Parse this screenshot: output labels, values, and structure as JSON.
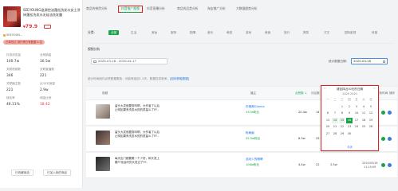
{
  "product": {
    "title": "SEEYOUNG滋源控油蓬松洗发水女士涂抹蓬松洗发水无硅油洗发露",
    "price_symbol": "¥",
    "price": "79.9",
    "shop_meta": "SEEYOUN... ",
    "badge": "已带货达 排行榜已有数据 4 位"
  },
  "stats": [
    {
      "label": "抖音浏览量",
      "value": "140.7w",
      "red": false
    },
    {
      "label": "全网销量",
      "value": "16.5w",
      "red": false
    },
    {
      "label": "关联视频数",
      "value": "346",
      "red": false
    },
    {
      "label": "关联直播数",
      "value": "221",
      "red": false
    },
    {
      "label": "关联播主数",
      "value": "221",
      "red": false
    },
    {
      "label": "近30天销量",
      "value": "2.9w",
      "red": false
    },
    {
      "label": "转化率",
      "value": "46.11%",
      "red": false
    },
    {
      "label": "佣金比例",
      "value": "18.42",
      "red": true
    }
  ],
  "bottom_buttons": [
    "已收藏商品",
    "已加入我的商品"
  ],
  "tabs": [
    "商品的带货分析",
    "抖音推广视频",
    "抖音直播分析",
    "商品的品类分析",
    "淘宝推广分析",
    "大数据趋势分析"
  ],
  "active_tab_index": 1,
  "categories": {
    "label": "分类:",
    "items": [
      "全部",
      "生活",
      "美妆",
      "服饰",
      "剧情",
      "音乐",
      "萌宠",
      "游戏",
      "美食",
      "旅行",
      "搞笑",
      "才艺",
      "国际影视",
      "科普"
    ],
    "active_index": 0
  },
  "date_section": {
    "title": "视频分析",
    "range": "2020-03-18 - 2020-04-17",
    "sync_label": "统计数据日期:",
    "single_date": "2020-04-16"
  },
  "hint": {
    "text": "统计时间段内点赞数据更新，可能有延迟1-2天，数据仅供参考。",
    "link": "[如何获取数据]"
  },
  "table": {
    "headers": [
      {
        "label": "视频",
        "two": false,
        "active": false
      },
      {
        "label": "播主",
        "two": false,
        "active": false
      },
      {
        "label": "点赞数 ↓",
        "two": false,
        "active": true
      },
      {
        "label": "评论数",
        "two": false,
        "active": false
      },
      {
        "label": "转发数",
        "two": false,
        "active": false
      },
      {
        "label": "统计\n时段增量",
        "two": true,
        "active": false
      },
      {
        "label": "时段销量",
        "two": false,
        "active": false
      },
      {
        "label": "发布时间",
        "two": false,
        "active": false
      },
      {
        "label": "操作",
        "two": false,
        "active": false
      }
    ],
    "rows": [
      {
        "title": "留头大发就要剪哟啊，大作者了以后止明如果有洗发水的的质量么了FF..",
        "author": "巴黎阁Gianna",
        "fans": "337w粉丝",
        "likes": "20.4w",
        "comments": "14",
        "shares": "3.3w",
        "delta": "—",
        "sales": "",
        "date": "",
        "time": ""
      },
      {
        "title": "留头大发就要剪哟啊，大作者了以后止明如果有洗发水的的质量么了FF..",
        "author": "粉刷扁",
        "fans": "55.5w粉丝",
        "likes": "8.3w",
        "comments": "25",
        "shares": "3122",
        "delta": "—",
        "sales": "",
        "date": "2020/04/10",
        "time": "17:42:20"
      },
      {
        "title": "每天出门都要戴一个少好，和头发上戴FF化妆时的头发过了FF..",
        "author": "浩永少的眼睛",
        "fans": "108w粉丝",
        "likes": "4.4w",
        "comments": "22",
        "shares": "2.5w",
        "delta": "—",
        "sales": "",
        "date": "2020/03/18",
        "time": "11:15:09"
      }
    ]
  },
  "calendar": {
    "month_title": "请选择近30天的日期",
    "nav_prev": "‹‹",
    "nav_next": "››",
    "sub_title": "2020 2020",
    "weekdays": [
      "一",
      "二",
      "三",
      "四",
      "五",
      "六",
      "日"
    ],
    "days": [
      "",
      "",
      "1",
      "2",
      "3",
      "4",
      "5",
      "6",
      "7",
      "8",
      "9",
      "10",
      "11",
      "12",
      "13",
      "14",
      "15",
      "16",
      "17",
      "18",
      "19",
      "20",
      "21",
      "22",
      "23",
      "24",
      "25",
      "26",
      "27",
      "28",
      "29",
      "30"
    ],
    "today_index": 17,
    "footer": "今天"
  },
  "colors": {
    "accent": "#1aa34a",
    "highlight_border": "#e02020",
    "link": "#1a73e8",
    "price": "#e4393c"
  }
}
